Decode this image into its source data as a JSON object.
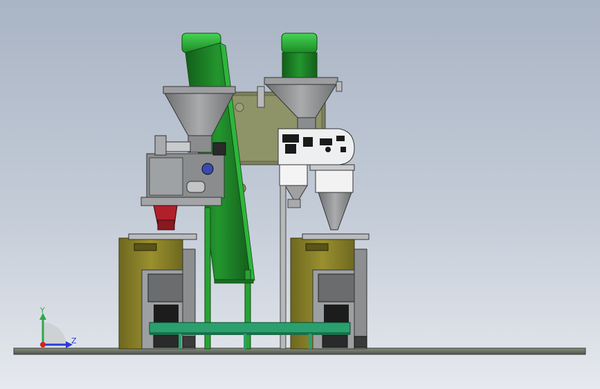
{
  "viewport": {
    "background_top": "#a9b4c4",
    "background_bottom": "#e6e9ee"
  },
  "triad": {
    "y_label": "Y",
    "z_label": "Z",
    "y_color": "#2ea84a",
    "z_color": "#2a3bd6",
    "origin_color": "#d42020"
  },
  "colors": {
    "conveyor_green": "#1e8a28",
    "conveyor_light": "#3cc24a",
    "hopper_gray": "#8f9193",
    "frame_olive": "#827a28",
    "bar_teal": "#2aa06e",
    "motor_red": "#b0202a",
    "ground": "#6d7366"
  },
  "icons": {
    "origin": "coordinate-triad-icon"
  }
}
